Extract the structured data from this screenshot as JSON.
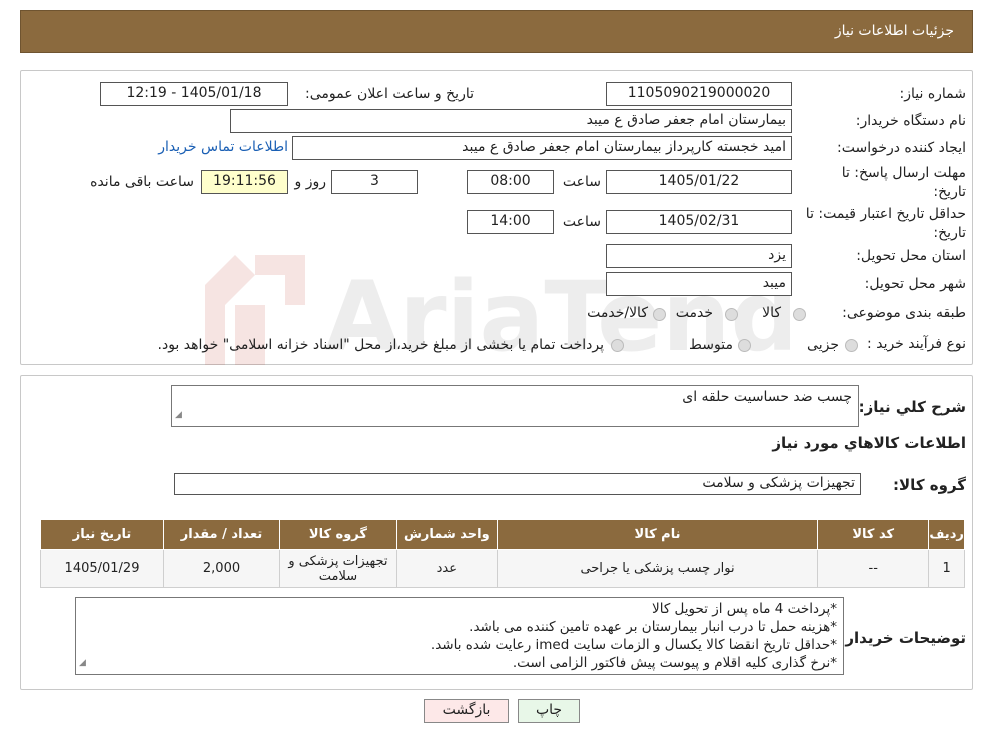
{
  "header": {
    "title": "جزئیات اطلاعات نیاز"
  },
  "form": {
    "need_number_label": "شماره نیاز:",
    "need_number": "1105090219000020",
    "announce_label": "تاریخ و ساعت اعلان عمومی:",
    "announce_value": "1405/01/18 - 12:19",
    "buyer_label": "نام دستگاه خریدار:",
    "buyer_value": "بیمارستان امام جعفر صادق  ع  میبد",
    "creator_label": "ایجاد کننده درخواست:",
    "creator_value": "امید خجسته کارپرداز بیمارستان امام جعفر صادق  ع  میبد",
    "contact_link": "اطلاعات تماس خریدار",
    "deadline_label_1": "مهلت ارسال پاسخ: تا",
    "deadline_label_2": "تاریخ:",
    "deadline_date": "1405/01/22",
    "time_label": "ساعت",
    "deadline_time": "08:00",
    "days_value": "3",
    "days_label": "روز و",
    "remaining_time": "19:11:56",
    "remaining_label": "ساعت باقی مانده",
    "validity_label_1": "حداقل تاریخ اعتبار قیمت: تا",
    "validity_label_2": "تاریخ:",
    "validity_date": "1405/02/31",
    "validity_time": "14:00",
    "province_label": "استان محل تحویل:",
    "province_value": "یزد",
    "city_label": "شهر محل تحویل:",
    "city_value": "میبد",
    "category_label": "طبقه بندی موضوعی:",
    "category_options": [
      "کالا",
      "خدمت",
      "کالا/خدمت"
    ],
    "process_label": "نوع فرآیند خرید :",
    "process_options": [
      "جزیی",
      "متوسط"
    ],
    "process_note": "پرداخت تمام یا بخشی از مبلغ خرید،از محل \"اسناد خزانه اسلامی\" خواهد بود."
  },
  "description": {
    "label": "شرح کلي نیاز:",
    "value": "چسب ضد حساسیت حلقه ای"
  },
  "goods_info_title": "اطلاعات کالاهاي مورد نیاز",
  "goods_group": {
    "label": "گروه کالا:",
    "value": "تجهیزات پزشکی و سلامت"
  },
  "table": {
    "headers": [
      "ردیف",
      "کد کالا",
      "نام کالا",
      "واحد شمارش",
      "گروه کالا",
      "تعداد / مقدار",
      "تاریخ نیاز"
    ],
    "rows": [
      [
        "1",
        "--",
        "نوار چسب پزشکی یا جراحی",
        "عدد",
        "تجهیزات پزشکی و سلامت",
        "2,000",
        "1405/01/29"
      ]
    ]
  },
  "buyer_notes": {
    "label": "توضیحات خریدار:",
    "lines": [
      "*پرداخت 4 ماه پس از تحویل کالا",
      "*هزینه حمل تا درب انبار بیمارستان بر عهده تامین کننده می باشد.",
      "*حداقل تاریخ انقضا کالا یکسال و الزمات سایت imed رعایت شده باشد.",
      "*نرخ گذاری کلیه اقلام و پیوست پیش فاکتور الزامی است."
    ]
  },
  "buttons": {
    "print": "چاپ",
    "back": "بازگشت"
  },
  "watermark": {
    "text": "AriaTender.neT"
  },
  "colors": {
    "header_bg": "#8b6a3e",
    "remaining_bg": "#ffffcc",
    "back_bg": "#fde8e8",
    "print_bg": "#e8f7e8",
    "link": "#1a5fb4"
  }
}
